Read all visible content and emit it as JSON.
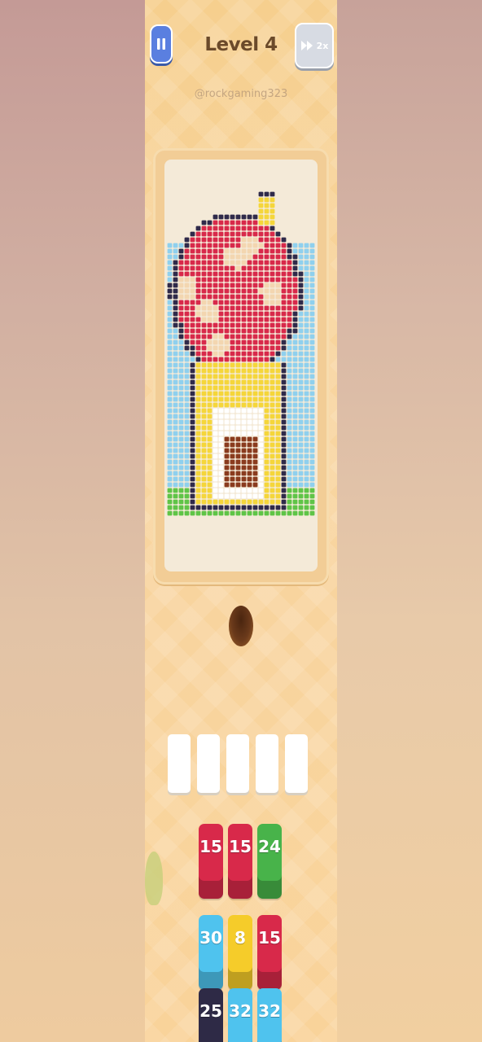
{
  "header": {
    "level_title": "Level 4",
    "watermark": "@rockgaming323",
    "speed_label": "2x"
  },
  "icons": {
    "pause": "pause-icon",
    "speed": "fast-forward-icon"
  },
  "colors": {
    "pause_button": "#5a7fe0",
    "sky": "#8fd0ee",
    "cap_red": "#d8294a",
    "spot_cream": "#f3d6b0",
    "house_yellow": "#f5d63a",
    "door_brown": "#8a3b1e",
    "grass_green": "#5fc447",
    "outline_navy": "#2f2a4a"
  },
  "tray": {
    "slot_count": 5
  },
  "tiles": [
    {
      "label": "15",
      "color": "#d8294a"
    },
    {
      "label": "15",
      "color": "#d8294a"
    },
    {
      "label": "24",
      "color": "#48b34a"
    },
    {
      "label": "30",
      "color": "#4fc3ee"
    },
    {
      "label": "8",
      "color": "#f5cc2a"
    },
    {
      "label": "15",
      "color": "#d8294a"
    },
    {
      "label": "25",
      "color": "#2e2a46"
    },
    {
      "label": "32",
      "color": "#4fc3ee"
    },
    {
      "label": "32",
      "color": "#4fc3ee"
    }
  ]
}
